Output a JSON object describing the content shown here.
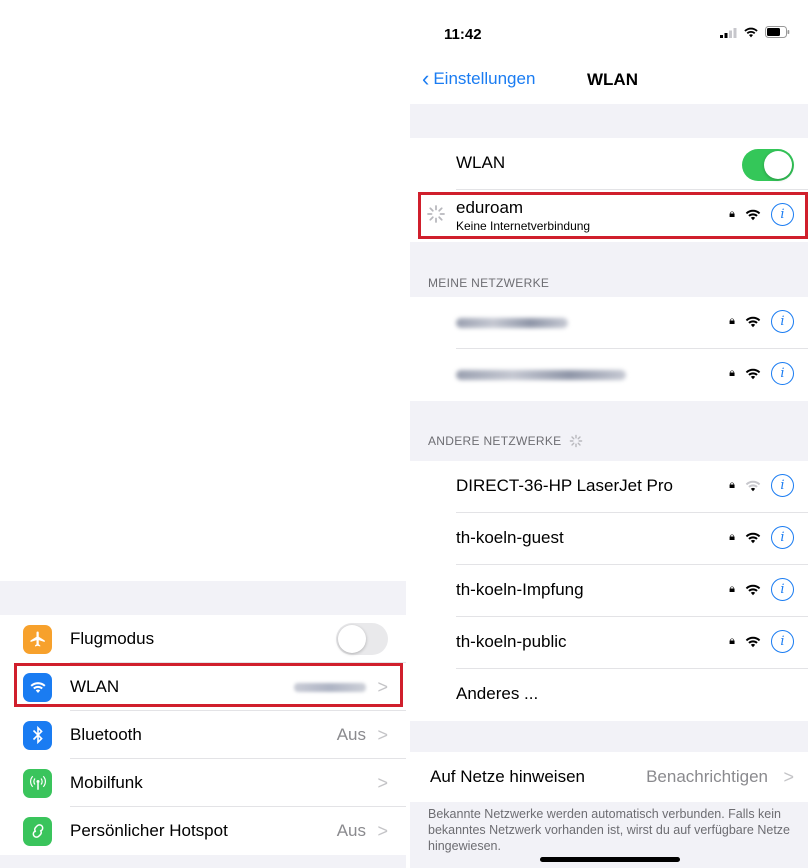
{
  "colors": {
    "accent": "#1a7cf2",
    "toggle_on": "#34c759",
    "highlight": "#d01f2c"
  },
  "settings": {
    "items": [
      {
        "label": "Flugmodus",
        "icon": "airplane-icon",
        "icon_color": "#f7a12c",
        "value": "",
        "toggle": "off"
      },
      {
        "label": "WLAN",
        "icon": "wifi-icon",
        "icon_color": "#1a7cf2",
        "value": "eduroam",
        "value_blurred": true
      },
      {
        "label": "Bluetooth",
        "icon": "bluetooth-icon",
        "icon_color": "#1a7cf2",
        "value": "Aus"
      },
      {
        "label": "Mobilfunk",
        "icon": "cellular-icon",
        "icon_color": "#3ac45c",
        "value": ""
      },
      {
        "label": "Persönlicher Hotspot",
        "icon": "hotspot-icon",
        "icon_color": "#3ac45c",
        "value": "Aus"
      }
    ]
  },
  "status_bar": {
    "time": "11:42"
  },
  "nav": {
    "back_label": "Einstellungen",
    "title": "WLAN"
  },
  "wlan": {
    "toggle_label": "WLAN",
    "connected": {
      "name": "eduroam",
      "status": "Keine Internetverbindung"
    },
    "my_networks_header": "MEINE NETZWERKE",
    "my_networks": [
      {
        "name": "(blurred network name)"
      },
      {
        "name": "(blurred network name)"
      }
    ],
    "other_networks_header": "ANDERE NETZWERKE",
    "other_networks": [
      {
        "name": "DIRECT-36-HP LaserJet Pro"
      },
      {
        "name": "th-koeln-guest"
      },
      {
        "name": "th-koeln-Impfung"
      },
      {
        "name": "th-koeln-public"
      }
    ],
    "other_label": "Anderes ...",
    "ask_join_label": "Auf Netze hinweisen",
    "ask_join_value": "Benachrichtigen",
    "footnote": "Bekannte Netzwerke werden automatisch verbunden. Falls kein bekanntes Netzwerk vorhanden ist, wirst du auf verfügbare Netze hingewiesen."
  }
}
